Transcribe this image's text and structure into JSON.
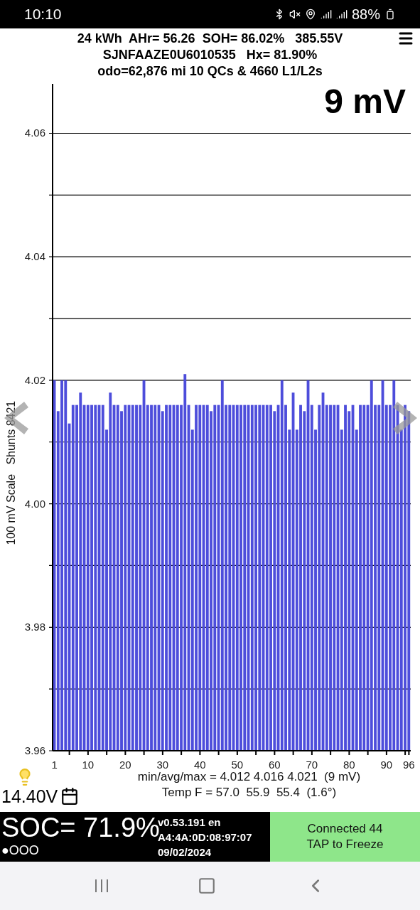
{
  "status_bar": {
    "time": "10:10",
    "battery": "88%"
  },
  "header": {
    "lines": [
      "24 kWh  AHr= 56.26  SOH= 86.02%   385.55V",
      "SJNFAAZE0U6010535   Hx= 81.90%",
      "odo=62,876 mi 10 QCs & 4660 L1/L2s"
    ]
  },
  "spread_label": "9 mV",
  "chart": {
    "chart_data": {
      "type": "bar",
      "ylabel": "100 mV Scale   Shunts 8421",
      "grid": true,
      "ylim": [
        3.96,
        4.068
      ],
      "yticks": [
        {
          "value": 3.96,
          "label": "3.96"
        },
        {
          "value": 3.98,
          "label": "3.98"
        },
        {
          "value": 4.0,
          "label": "4.00"
        },
        {
          "value": 4.02,
          "label": "4.02"
        },
        {
          "value": 4.04,
          "label": "4.04"
        },
        {
          "value": 4.06,
          "label": "4.06"
        }
      ],
      "x": [
        1,
        2,
        3,
        4,
        5,
        6,
        7,
        8,
        9,
        10,
        11,
        12,
        13,
        14,
        15,
        16,
        17,
        18,
        19,
        20,
        21,
        22,
        23,
        24,
        25,
        26,
        27,
        28,
        29,
        30,
        31,
        32,
        33,
        34,
        35,
        36,
        37,
        38,
        39,
        40,
        41,
        42,
        43,
        44,
        45,
        46,
        47,
        48,
        49,
        50,
        51,
        52,
        53,
        54,
        55,
        56,
        57,
        58,
        59,
        60,
        61,
        62,
        63,
        64,
        65,
        66,
        67,
        68,
        69,
        70,
        71,
        72,
        73,
        74,
        75,
        76,
        77,
        78,
        79,
        80,
        81,
        82,
        83,
        84,
        85,
        86,
        87,
        88,
        89,
        90,
        91,
        92,
        93,
        94,
        95,
        96
      ],
      "xlim": [
        0.5,
        96.5
      ],
      "xticks": [
        {
          "value": 1,
          "label": "1"
        },
        {
          "value": 10,
          "label": "10"
        },
        {
          "value": 20,
          "label": "20"
        },
        {
          "value": 30,
          "label": "30"
        },
        {
          "value": 40,
          "label": "40"
        },
        {
          "value": 50,
          "label": "50"
        },
        {
          "value": 60,
          "label": "60"
        },
        {
          "value": 70,
          "label": "70"
        },
        {
          "value": 80,
          "label": "80"
        },
        {
          "value": 90,
          "label": "90"
        },
        {
          "value": 96,
          "label": "96"
        }
      ],
      "series": [
        {
          "color": "#4d4ddb",
          "values": [
            4.02,
            4.015,
            4.02,
            4.02,
            4.013,
            4.016,
            4.016,
            4.018,
            4.016,
            4.016,
            4.016,
            4.016,
            4.016,
            4.016,
            4.012,
            4.018,
            4.016,
            4.016,
            4.015,
            4.016,
            4.016,
            4.016,
            4.016,
            4.016,
            4.02,
            4.016,
            4.016,
            4.016,
            4.016,
            4.015,
            4.016,
            4.016,
            4.016,
            4.016,
            4.016,
            4.021,
            4.016,
            4.012,
            4.016,
            4.016,
            4.016,
            4.016,
            4.015,
            4.016,
            4.016,
            4.02,
            4.016,
            4.016,
            4.016,
            4.016,
            4.016,
            4.016,
            4.016,
            4.016,
            4.016,
            4.016,
            4.016,
            4.016,
            4.016,
            4.015,
            4.016,
            4.02,
            4.016,
            4.012,
            4.018,
            4.012,
            4.016,
            4.015,
            4.02,
            4.016,
            4.012,
            4.016,
            4.018,
            4.016,
            4.016,
            4.016,
            4.016,
            4.012,
            4.016,
            4.015,
            4.016,
            4.012,
            4.016,
            4.016,
            4.016,
            4.02,
            4.016,
            4.016,
            4.02,
            4.016,
            4.016,
            4.02,
            4.016,
            4.012,
            4.016,
            4.015
          ]
        }
      ]
    }
  },
  "stats": [
    "min/avg/max = 4.012 4.016 4.021  (9 mV)",
    "Temp F = 57.0  55.9  55.4  (1.6°)"
  ],
  "aux_voltage": "14.40V",
  "soc": {
    "value": "SOC= 71.9%",
    "indicator": "●OOO"
  },
  "info": [
    "v0.53.191 en",
    "A4:4A:0D:08:97:07",
    "09/02/2024"
  ],
  "connection": [
    "Connected 44",
    "TAP to Freeze"
  ]
}
